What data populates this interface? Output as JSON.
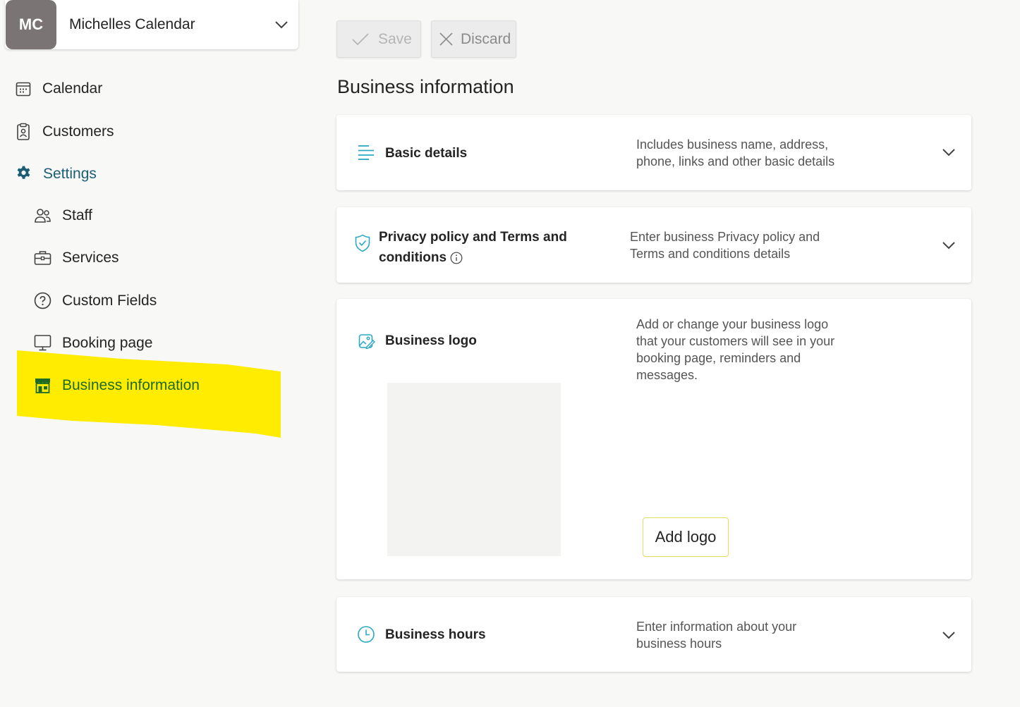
{
  "calendar": {
    "initials": "MC",
    "name": "Michelles Calendar"
  },
  "sidebar": {
    "items": [
      {
        "label": "Calendar"
      },
      {
        "label": "Customers"
      },
      {
        "label": "Settings"
      },
      {
        "label": "Staff"
      },
      {
        "label": "Services"
      },
      {
        "label": "Custom Fields"
      },
      {
        "label": "Booking page"
      },
      {
        "label": "Business information"
      }
    ]
  },
  "toolbar": {
    "save_label": "Save",
    "discard_label": "Discard"
  },
  "page": {
    "title": "Business information"
  },
  "sections": {
    "basic": {
      "title": "Basic details",
      "desc_line1": "Includes business name, address,",
      "desc_line2": "phone, links and other basic details"
    },
    "privacy": {
      "title_line1": "Privacy policy and Terms and",
      "title_line2": "conditions",
      "desc_line1": "Enter business Privacy policy and",
      "desc_line2": "Terms and conditions details"
    },
    "logo": {
      "title": "Business logo",
      "desc_line1": "Add or change your business logo",
      "desc_line2": "that your customers will see in your",
      "desc_line3": "booking page, reminders and",
      "desc_line4": "messages.",
      "add_label": "Add logo"
    },
    "hours": {
      "title": "Business hours",
      "desc_line1": "Enter information about your",
      "desc_line2": "business hours"
    }
  },
  "colors": {
    "highlight": "#ffec00",
    "settings_accent": "#1b5e73",
    "active_accent": "#1f6b26",
    "icon_teal": "#2aa8c4"
  }
}
